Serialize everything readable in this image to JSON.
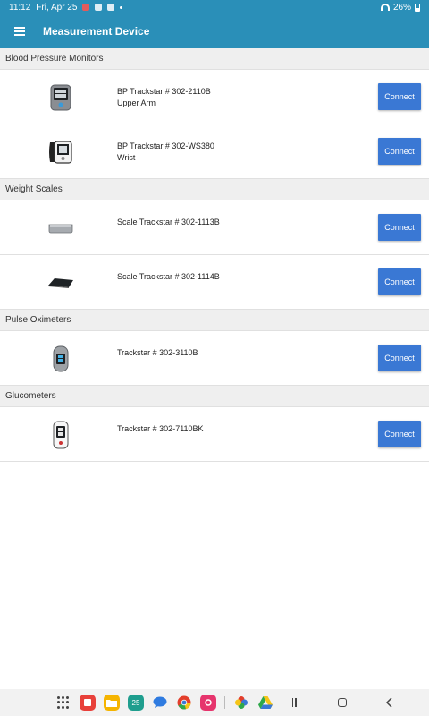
{
  "status_bar": {
    "time": "11:12",
    "date": "Fri, Apr 25",
    "battery": "26%"
  },
  "app_bar": {
    "title": "Measurement Device"
  },
  "sections": [
    {
      "header": "Blood Pressure Monitors",
      "devices": [
        {
          "name": "BP Trackstar # 302-2110B",
          "subtitle": "Upper Arm",
          "button": "Connect",
          "icon": "bp-monitor-upper-arm"
        },
        {
          "name": "BP Trackstar # 302-WS380",
          "subtitle": "Wrist",
          "button": "Connect",
          "icon": "bp-monitor-wrist"
        }
      ]
    },
    {
      "header": "Weight Scales",
      "devices": [
        {
          "name": "Scale Trackstar # 302-1113B",
          "subtitle": "",
          "button": "Connect",
          "icon": "scale-silver"
        },
        {
          "name": "Scale Trackstar # 302-1114B",
          "subtitle": "",
          "button": "Connect",
          "icon": "scale-black"
        }
      ]
    },
    {
      "header": "Pulse Oximeters",
      "devices": [
        {
          "name": "Trackstar # 302-3110B",
          "subtitle": "",
          "button": "Connect",
          "icon": "pulse-oximeter"
        }
      ]
    },
    {
      "header": "Glucometers",
      "devices": [
        {
          "name": "Trackstar # 302-7110BK",
          "subtitle": "",
          "button": "Connect",
          "icon": "glucometer"
        }
      ]
    }
  ],
  "taskbar": {
    "calendar_day": "25",
    "apps": [
      "apps-grid-icon",
      "notes-app-icon",
      "files-app-icon",
      "calendar-app-icon",
      "messages-app-icon",
      "chrome-app-icon",
      "camera-app-icon",
      "photos-app-icon",
      "drive-app-icon"
    ]
  },
  "colors": {
    "primary": "#2a8fb8",
    "button": "#3a78d4",
    "section_bg": "#efefef"
  }
}
